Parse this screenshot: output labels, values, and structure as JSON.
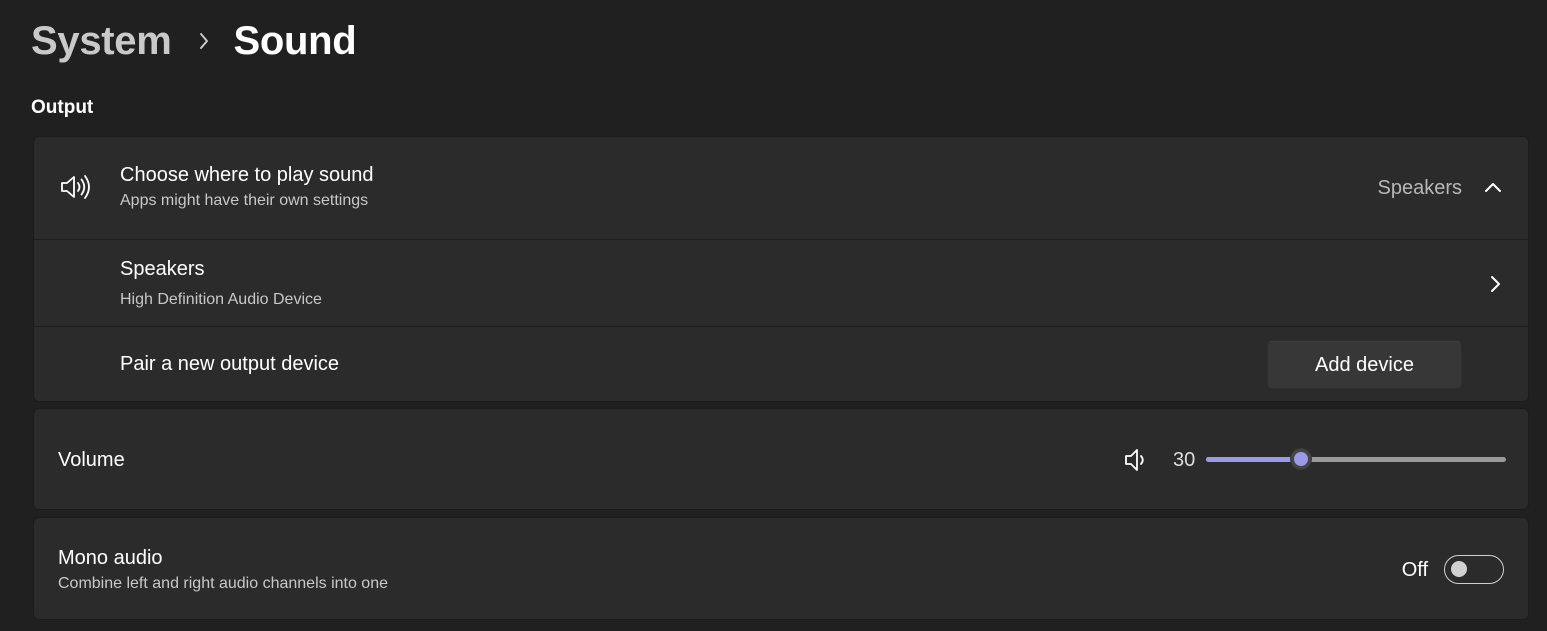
{
  "breadcrumb": {
    "parent": "System",
    "current": "Sound"
  },
  "output": {
    "section_title": "Output",
    "choose": {
      "title": "Choose where to play sound",
      "subtitle": "Apps might have their own settings",
      "selected": "Speakers",
      "icon": "speaker-volume-icon",
      "expand_icon": "chevron-up-icon"
    },
    "device": {
      "name": "Speakers",
      "description": "High Definition Audio Device",
      "icon": "chevron-right-icon"
    },
    "pair": {
      "label": "Pair a new output device",
      "button_label": "Add device"
    }
  },
  "volume": {
    "label": "Volume",
    "value": "30",
    "level_percent": 30,
    "icon": "speaker-low-icon"
  },
  "mono": {
    "title": "Mono audio",
    "subtitle": "Combine left and right audio channels into one",
    "state_label": "Off",
    "on": false
  },
  "colors": {
    "background": "#202020",
    "card": "#2b2b2b",
    "accent": "#9a9ae6"
  }
}
